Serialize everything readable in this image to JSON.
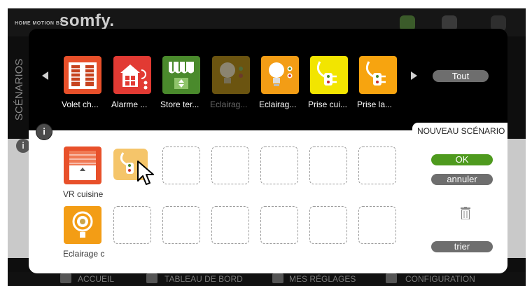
{
  "app": {
    "brand_small": "HOME MOTION BY",
    "brand_big": "somfy.",
    "side_label": "SCÉNARIOS",
    "side_info": "i",
    "footer": [
      {
        "label": "ACCUEIL"
      },
      {
        "label": "TABLEAU DE BORD"
      },
      {
        "label": "MES RÉGLAGES"
      },
      {
        "label": "CONFIGURATION"
      }
    ]
  },
  "modal": {
    "tout_button": "Tout",
    "info_button": "i",
    "nouveau_title": "NOUVEAU SCÉNARIO",
    "categories": [
      {
        "label": "Volet ch...",
        "icon": "shutter-icon",
        "color": "#e8502a",
        "dimmed": false
      },
      {
        "label": "Alarme ...",
        "icon": "house-alarm-icon",
        "color": "#e23a33",
        "dimmed": false
      },
      {
        "label": "Store ter...",
        "icon": "awning-icon",
        "color": "#4a8a2c",
        "dimmed": false
      },
      {
        "label": "Eclairag...",
        "icon": "bulb-icon",
        "color": "#6b5410",
        "dimmed": true
      },
      {
        "label": "Eclairag...",
        "icon": "bulb-icon",
        "color": "#f39d15",
        "dimmed": false
      },
      {
        "label": "Prise cui...",
        "icon": "plug-icon",
        "color": "#f2e500",
        "dimmed": false
      },
      {
        "label": "Prise la...",
        "icon": "plug-icon",
        "color": "#f7a40f",
        "dimmed": false
      }
    ],
    "actuators": [
      {
        "label": "VR cuisine",
        "icon": "shutter-icon",
        "color": "#e8502a"
      },
      {
        "label": "Eclairage c",
        "icon": "bulb-ring-icon",
        "color": "#f39d15"
      }
    ],
    "ok_label": "OK",
    "annuler_label": "annuler",
    "trier_label": "trier",
    "colors": {
      "ok": "#4e9a1e",
      "gray_btn": "#6e6e6e"
    }
  }
}
